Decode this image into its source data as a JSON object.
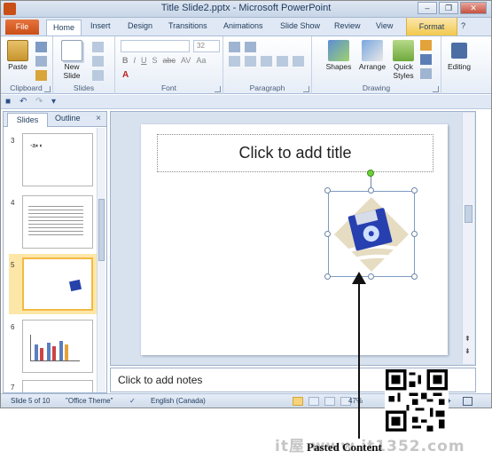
{
  "window": {
    "title": "Title Slide2.pptx - Microsoft PowerPoint"
  },
  "tabs": [
    "File",
    "Home",
    "Insert",
    "Design",
    "Transitions",
    "Animations",
    "Slide Show",
    "Review",
    "View",
    "Format"
  ],
  "ribbon": {
    "clipboard": {
      "label": "Clipboard",
      "paste": "Paste"
    },
    "slides": {
      "label": "Slides",
      "new_slide": "New Slide",
      "new_slide_line2": "Slide"
    },
    "font": {
      "label": "Font",
      "size": "32",
      "buttons": [
        "B",
        "I",
        "U",
        "S",
        "abc",
        "AV",
        "Aa",
        "A"
      ]
    },
    "paragraph": {
      "label": "Paragraph"
    },
    "drawing": {
      "label": "Drawing",
      "shapes": "Shapes",
      "arrange": "Arrange",
      "quick_styles": "Quick",
      "quick_styles_line2": "Styles"
    },
    "editing": {
      "label": "Editing"
    }
  },
  "slides_pane": {
    "tab_slides": "Slides",
    "tab_outline": "Outline",
    "close": "×",
    "thumbs": [
      {
        "num": "3",
        "text": "-a◐◐"
      },
      {
        "num": "4"
      },
      {
        "num": "5"
      },
      {
        "num": "6"
      },
      {
        "num": "7"
      }
    ]
  },
  "slide": {
    "title_placeholder": "Click to add title"
  },
  "notes": {
    "placeholder": "Click to add notes"
  },
  "status": {
    "slide_info": "Slide 5 of 10",
    "theme": "\"Office Theme\"",
    "language": "English (Canada)",
    "zoom": "47%"
  },
  "annotation": {
    "label": "Pasted Content",
    "watermark": "it屋 www.it1352.com"
  },
  "colors": {
    "file_tab": "#d35f26",
    "format_tab": "#f2c94c",
    "selection": "#f4b942"
  }
}
